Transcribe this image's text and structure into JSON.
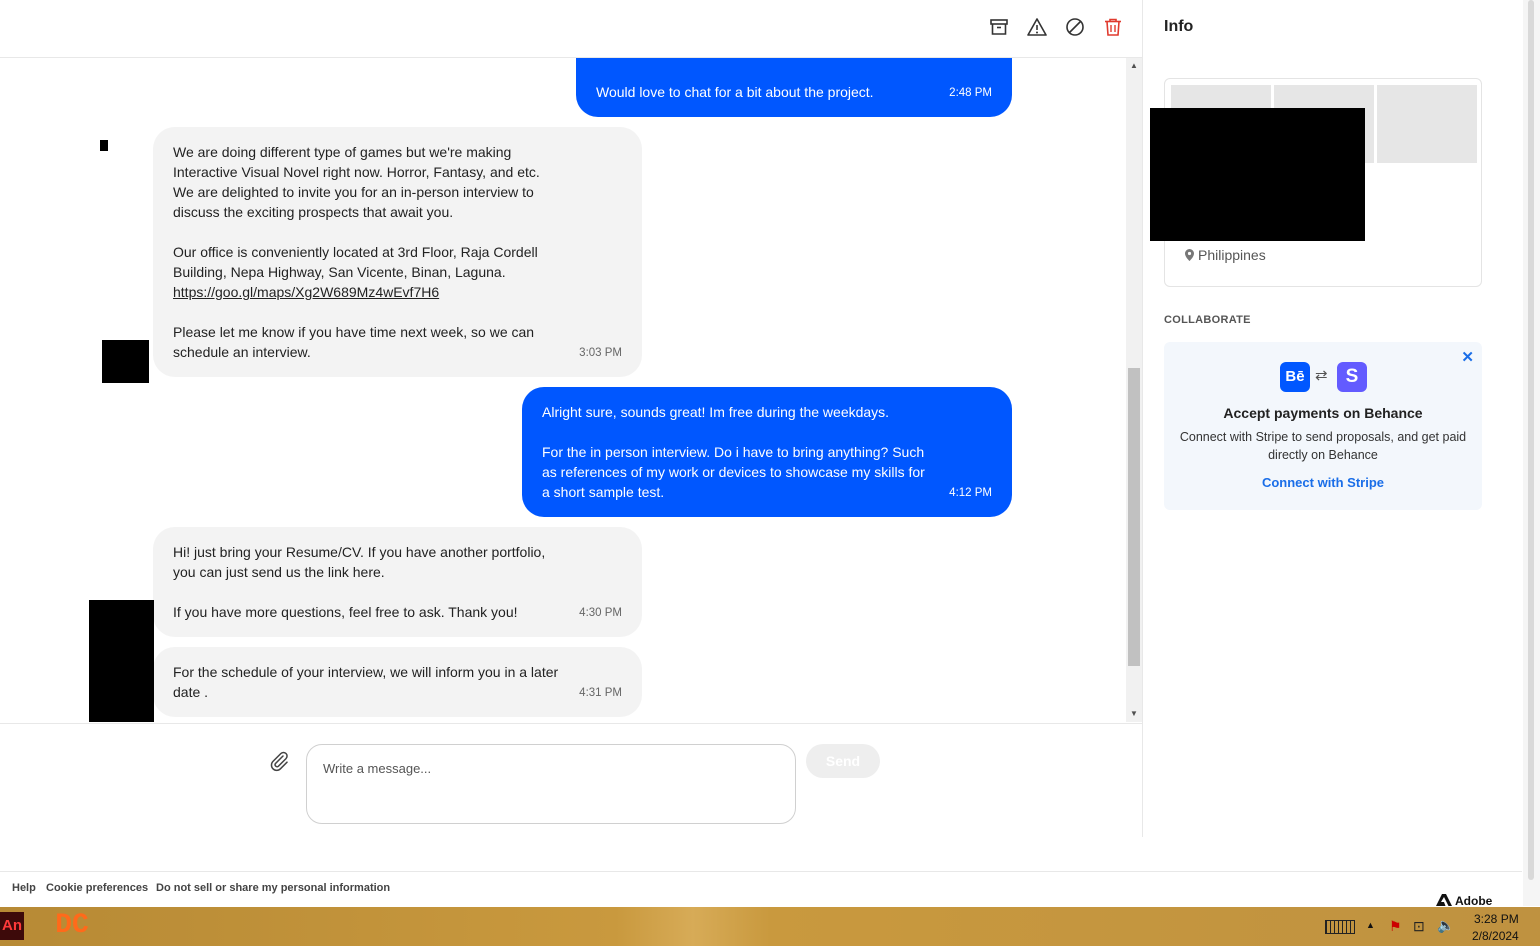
{
  "header": {
    "icons": [
      "archive-icon",
      "warning-icon",
      "block-icon",
      "trash-icon"
    ]
  },
  "messages": [
    {
      "direction": "out",
      "text": "Would love to chat for a bit about the project.",
      "time": "2:48 PM"
    },
    {
      "direction": "in",
      "text_before_link": "We are doing different type of games but we're making\nInteractive Visual Novel right now. Horror, Fantasy, and etc.\nWe are delighted to invite you for an in-person interview to\ndiscuss the exciting prospects that await you.\n\nOur office is conveniently located at 3rd Floor, Raja Cordell\nBuilding, Nepa Highway, San Vicente, Binan, Laguna.",
      "link": "https://goo.gl/maps/Xg2W689Mz4wEvf7H6",
      "text_after_link": "Please let me know if you have time next week, so we can\nschedule an interview.",
      "time": "3:03 PM"
    },
    {
      "direction": "out",
      "text": "Alright sure, sounds great! Im free during the weekdays.\n\nFor the in person interview. Do i have to bring anything? Such\nas references of my work or devices to showcase my skills for\na short sample test.",
      "time": "4:12 PM"
    },
    {
      "direction": "in",
      "text": "Hi! just bring your Resume/CV. If you have another portfolio,\nyou can just send us the link here.\n\nIf you have more questions, feel free to ask. Thank you!",
      "time": "4:30 PM"
    },
    {
      "direction": "in",
      "text": "For the schedule of your interview, we will inform you in a later\ndate .",
      "time": "4:31 PM"
    }
  ],
  "composer": {
    "placeholder": "Write a message...",
    "send_label": "Send"
  },
  "sidebar": {
    "title": "Info",
    "location": "Philippines",
    "collaborate_title": "COLLABORATE",
    "stripe": {
      "be_logo": "Bē",
      "swap_glyph": "⇄",
      "s_logo": "S",
      "heading": "Accept payments on Behance",
      "body": "Connect with Stripe to send proposals, and get paid directly on Behance",
      "link": "Connect with Stripe",
      "be_color": "#0057ff",
      "stripe_color": "#635bff"
    }
  },
  "footer": {
    "links": [
      "Help",
      "Cookie preferences",
      "Do not sell or share my personal information"
    ],
    "brand": "Adobe"
  },
  "taskbar": {
    "apps": [
      "An",
      "DC"
    ],
    "time": "3:28 PM",
    "date": "2/8/2024"
  }
}
